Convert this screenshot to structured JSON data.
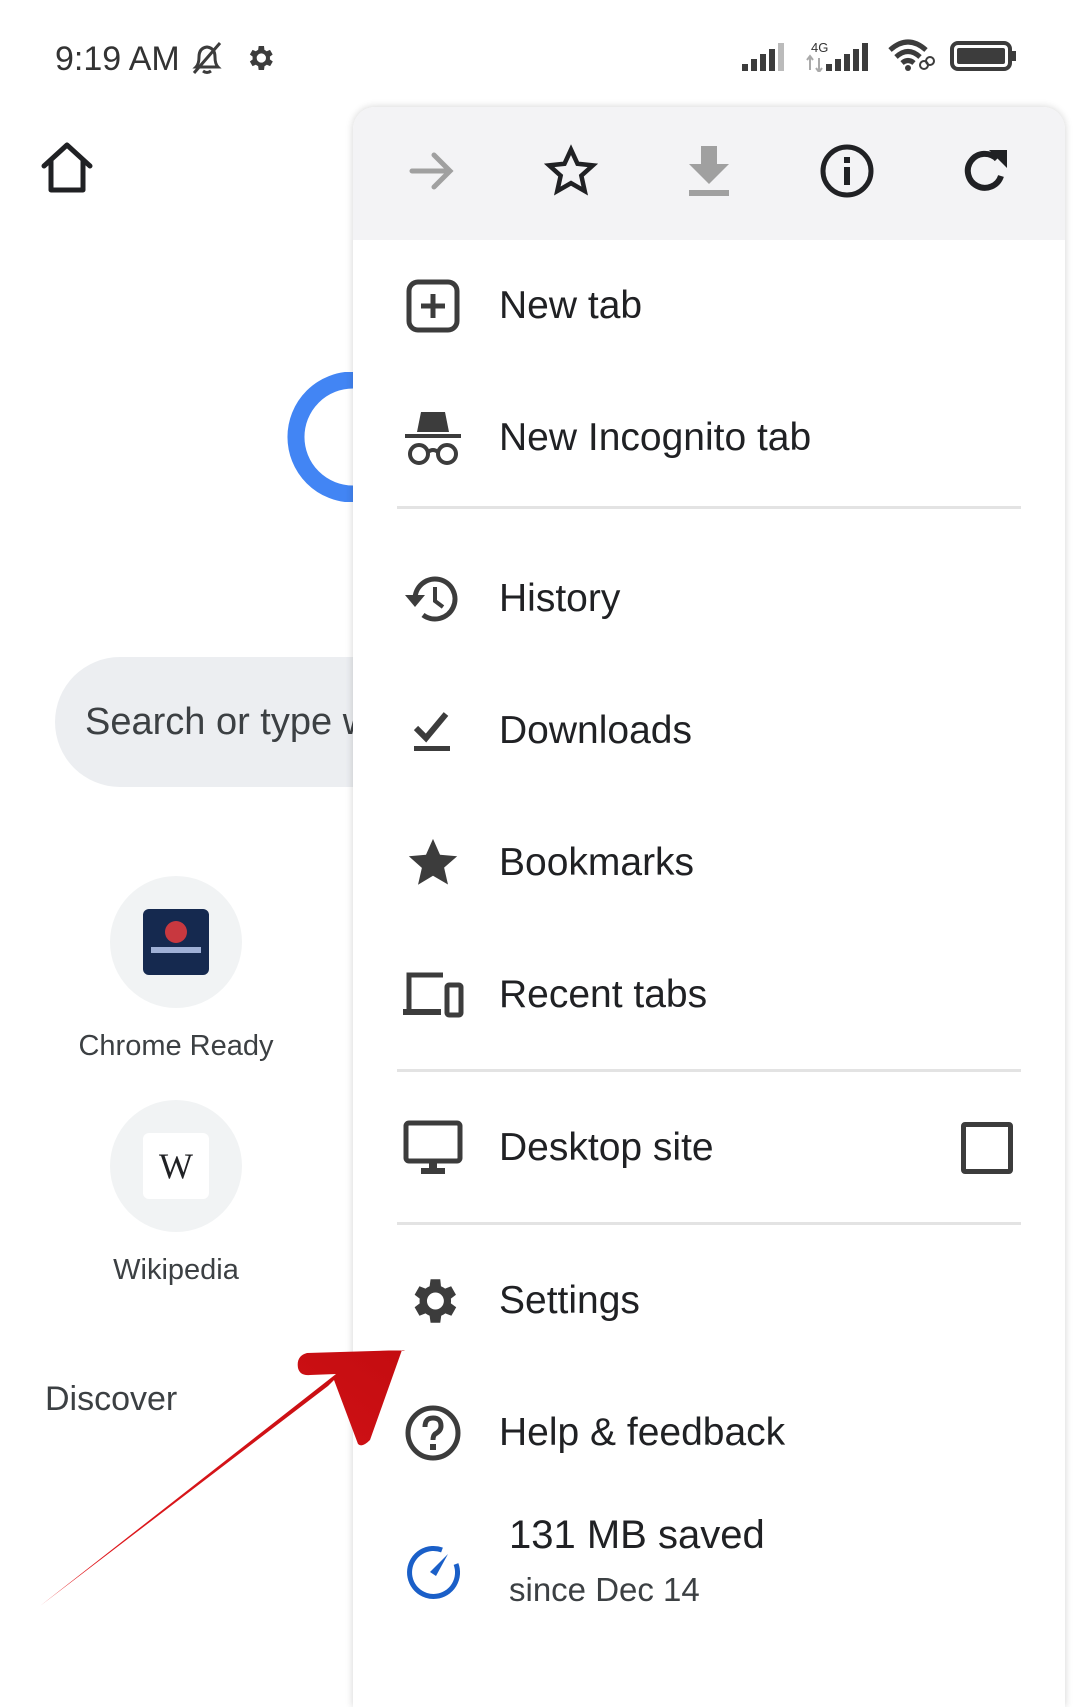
{
  "status_bar": {
    "time": "9:19 AM",
    "left_icons": [
      "bell-muted-icon",
      "gear-icon"
    ],
    "network_label": "4G",
    "right_icons": [
      "signal-sim1-icon",
      "signal-4g-icon",
      "wifi-icon",
      "battery-icon"
    ]
  },
  "background_page": {
    "search_placeholder": "Search or type web address",
    "search_visible_text": "Search or type w",
    "shortcuts": [
      {
        "label": "Chrome Ready",
        "icon": "chrome-ready-favicon"
      },
      {
        "label": "Wikipedia",
        "icon": "wikipedia-favicon",
        "glyph": "W"
      }
    ],
    "discover_heading": "Discover"
  },
  "menu": {
    "toolbar": [
      {
        "name": "forward",
        "icon": "arrow-right-icon",
        "enabled": false
      },
      {
        "name": "bookmark",
        "icon": "star-outline-icon",
        "enabled": true
      },
      {
        "name": "download",
        "icon": "download-icon",
        "enabled": false
      },
      {
        "name": "page-info",
        "icon": "info-icon",
        "enabled": true
      },
      {
        "name": "reload",
        "icon": "reload-icon",
        "enabled": true
      }
    ],
    "items": [
      {
        "label": "New tab",
        "icon": "plus-box-icon"
      },
      {
        "label": "New Incognito tab",
        "icon": "incognito-icon"
      },
      {
        "label": "History",
        "icon": "history-icon"
      },
      {
        "label": "Downloads",
        "icon": "download-done-icon"
      },
      {
        "label": "Bookmarks",
        "icon": "star-filled-icon"
      },
      {
        "label": "Recent tabs",
        "icon": "devices-icon"
      },
      {
        "label": "Desktop site",
        "icon": "monitor-icon",
        "checked": false
      },
      {
        "label": "Settings",
        "icon": "settings-gear-icon"
      },
      {
        "label": "Help & feedback",
        "icon": "help-icon"
      }
    ],
    "data_saver": {
      "saved": "131 MB saved",
      "since": "since Dec 14",
      "icon": "speedometer-icon"
    }
  },
  "annotation": {
    "type": "red arrow pointing to Settings",
    "color": "#d9131a"
  },
  "colors": {
    "accent_blue": "#4285f4",
    "saver_blue": "#1a5fc8",
    "toolbar_bg": "#f3f3f5",
    "icon_dark": "#3c3c3c",
    "icon_disabled": "#a0a0a0"
  }
}
